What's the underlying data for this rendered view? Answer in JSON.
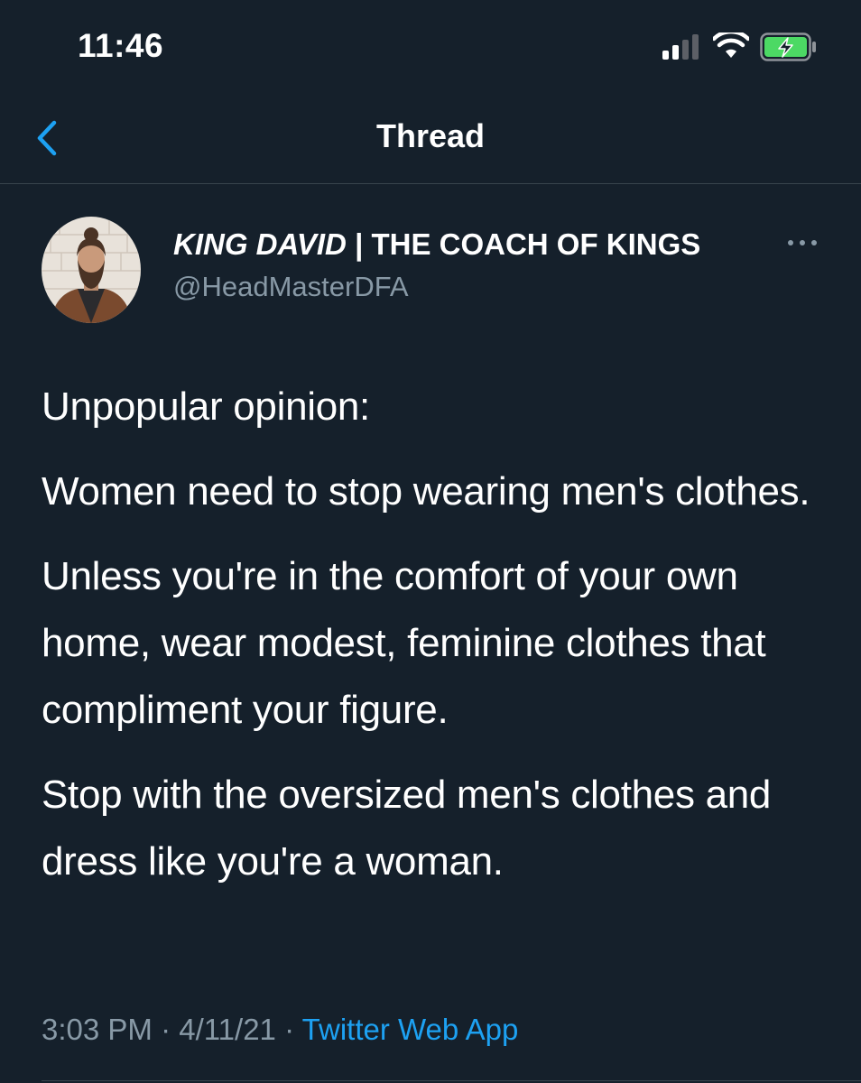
{
  "status_bar": {
    "time": "11:46",
    "signal_icon": "cellular-signal-icon",
    "wifi_icon": "wifi-icon",
    "battery_icon": "battery-charging-icon",
    "battery_color": "#4cd964"
  },
  "header": {
    "back_icon": "chevron-left-icon",
    "title": "Thread"
  },
  "tweet": {
    "author": {
      "name_italic": "KING DAVID",
      "name_rest": "| THE COACH OF KINGS",
      "handle": "@HeadMasterDFA",
      "avatar_icon": "user-avatar"
    },
    "more_icon": "ellipsis-icon",
    "paragraphs": [
      "Unpopular opinion:",
      "Women need to stop wearing men's clothes.",
      "Unless you're in the comfort of your own home, wear modest, feminine clothes that compliment your figure.",
      "Stop with the oversized men's clothes and dress like you're a woman."
    ],
    "time": "3:03 PM",
    "separator": "·",
    "date": "4/11/21",
    "source": "Twitter Web App"
  },
  "colors": {
    "background": "#15202b",
    "secondary_text": "#8899a6",
    "accent": "#1da1f2",
    "divider": "#38444d"
  }
}
